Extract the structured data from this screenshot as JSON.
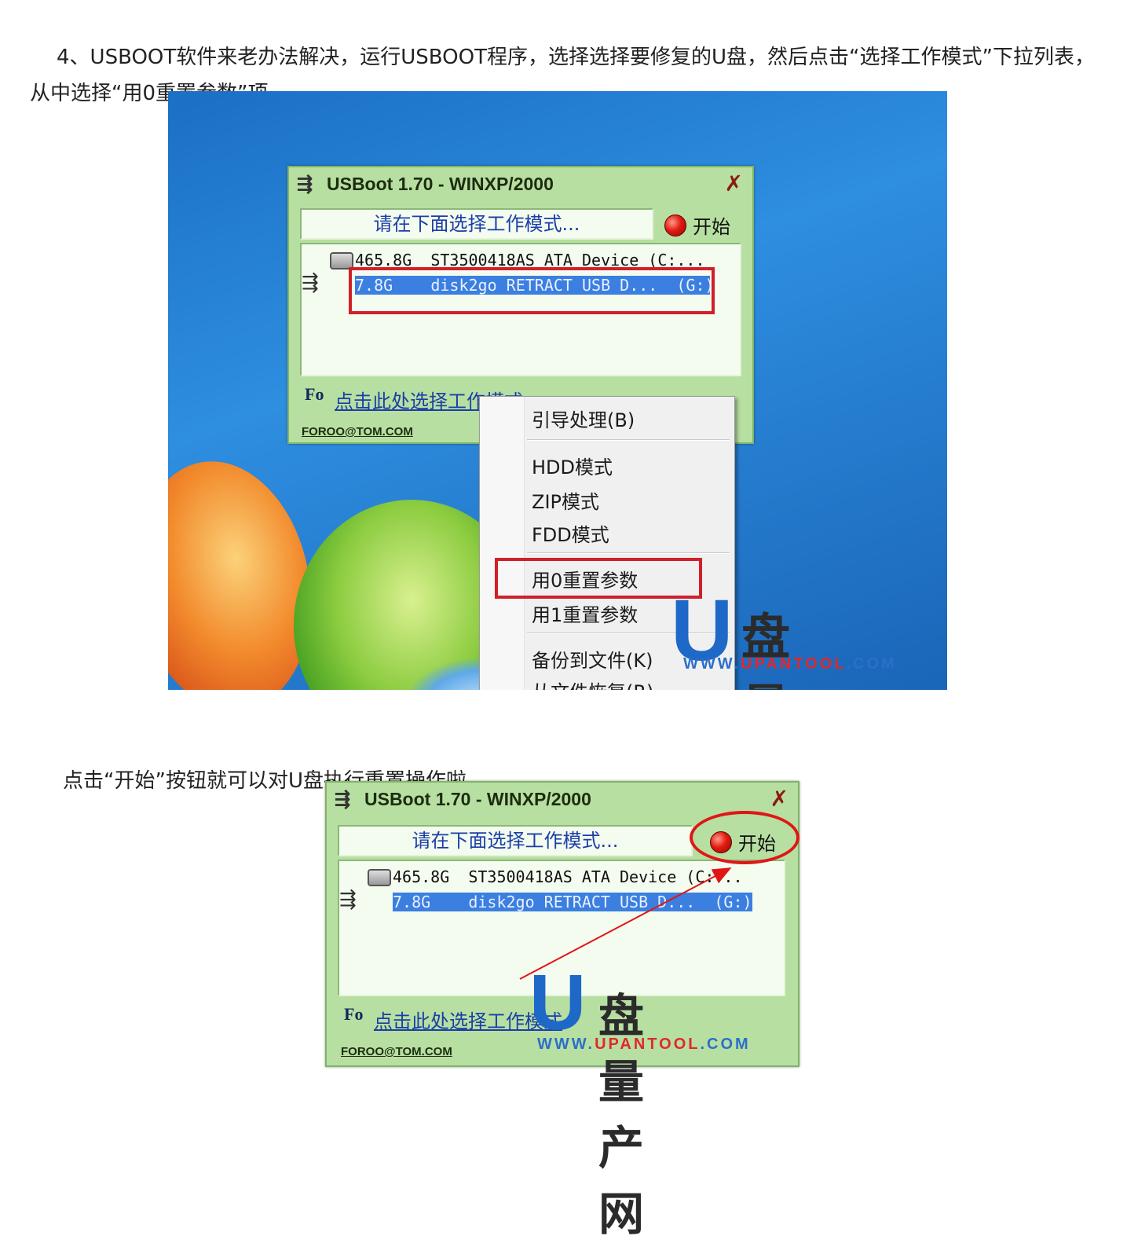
{
  "article": {
    "para1": "4、USBOOT软件来老办法解决，运行USBOOT程序，选择选择要修复的U盘，然后点击“选择工作模式”下拉列表，从中选择“用0重置参数”项。",
    "para2": "点击“开始”按钮就可以对U盘执行重置操作啦。"
  },
  "app": {
    "title": "USBoot 1.70 - WINXP/2000",
    "close_glyph": "✗",
    "mode_prompt": "请在下面选择工作模式...",
    "start_label": "开始",
    "devices": [
      "465.8G  ST3500418AS ATA Device (C:...",
      "7.8G    disk2go RETRACT USB D...  (G:)"
    ],
    "select_mode_link": "点击此处选择工作模式",
    "email": "FOROO@TOM.COM",
    "fo_logo": "Fo"
  },
  "context_menu": {
    "items": [
      "引导处理(B)",
      "HDD模式",
      "ZIP模式",
      "FDD模式",
      "用0重置参数",
      "用1重置参数",
      "备份到文件(K)",
      "从文件恢复(R)"
    ],
    "highlighted": "用0重置参数"
  },
  "watermark": {
    "letter": "U",
    "name": "盘量产网",
    "url_prefix": "WWW.",
    "url_mid": "UPANTOOL",
    "url_suffix": ".COM"
  },
  "colors": {
    "window_bg": "#b7dfa1",
    "selection": "#3b7fe0",
    "highlight_box": "#d0202a",
    "link": "#1a3fa8"
  }
}
